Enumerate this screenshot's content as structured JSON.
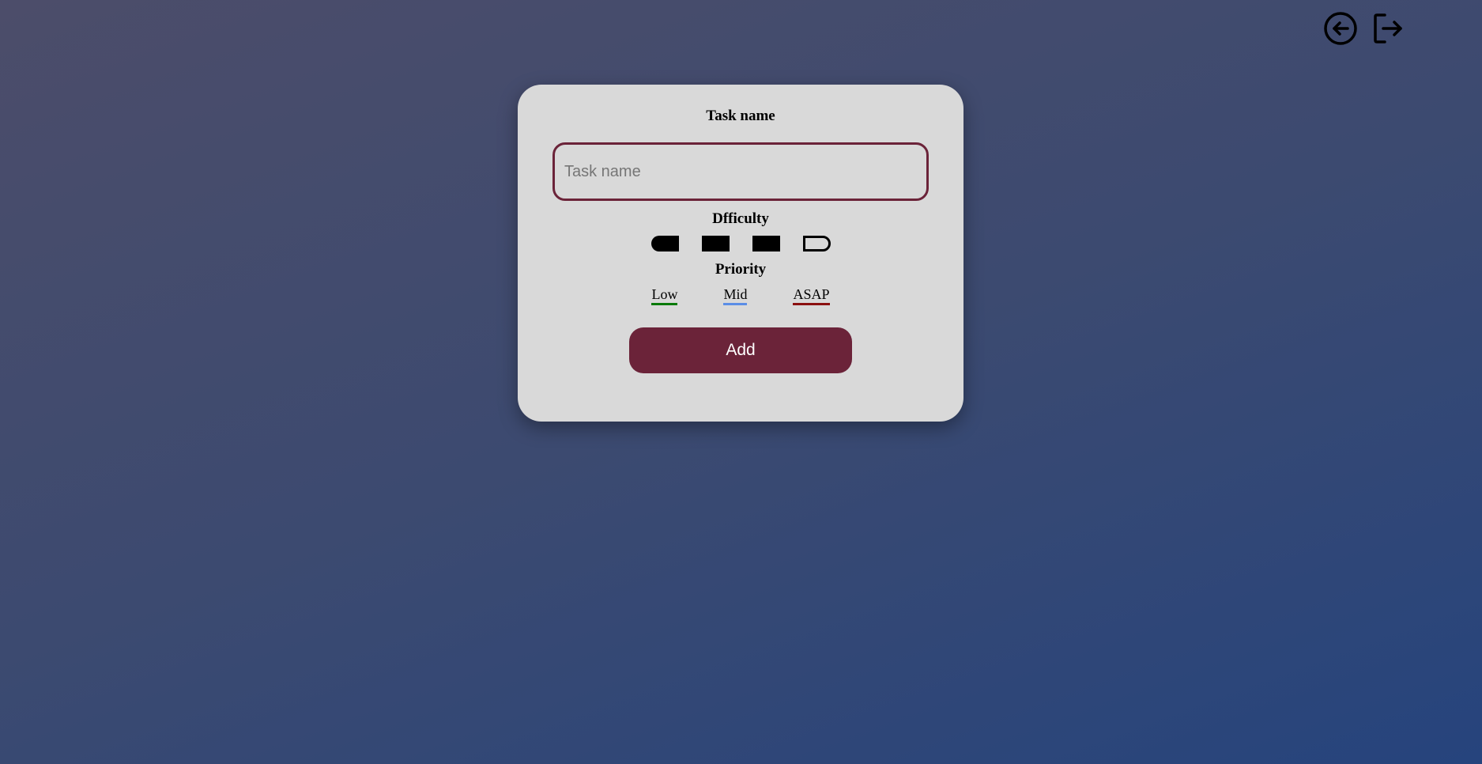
{
  "header": {
    "icons": [
      "back-arrow-icon",
      "logout-icon"
    ]
  },
  "form": {
    "task_label": "Task name",
    "task_input": {
      "value": "",
      "placeholder": "Task name"
    },
    "difficulty_label": "Dfficulty",
    "difficulty": {
      "max_level": 4,
      "selected_level": 3
    },
    "priority_label": "Priority",
    "priority_options": [
      {
        "label": "Low",
        "color": "#0a7a0a"
      },
      {
        "label": "Mid",
        "color": "#5b8ee6"
      },
      {
        "label": "ASAP",
        "color": "#8b1010"
      }
    ],
    "add_label": "Add"
  },
  "colors": {
    "accent": "#6b2339",
    "card_background": "#d9d9d9"
  }
}
